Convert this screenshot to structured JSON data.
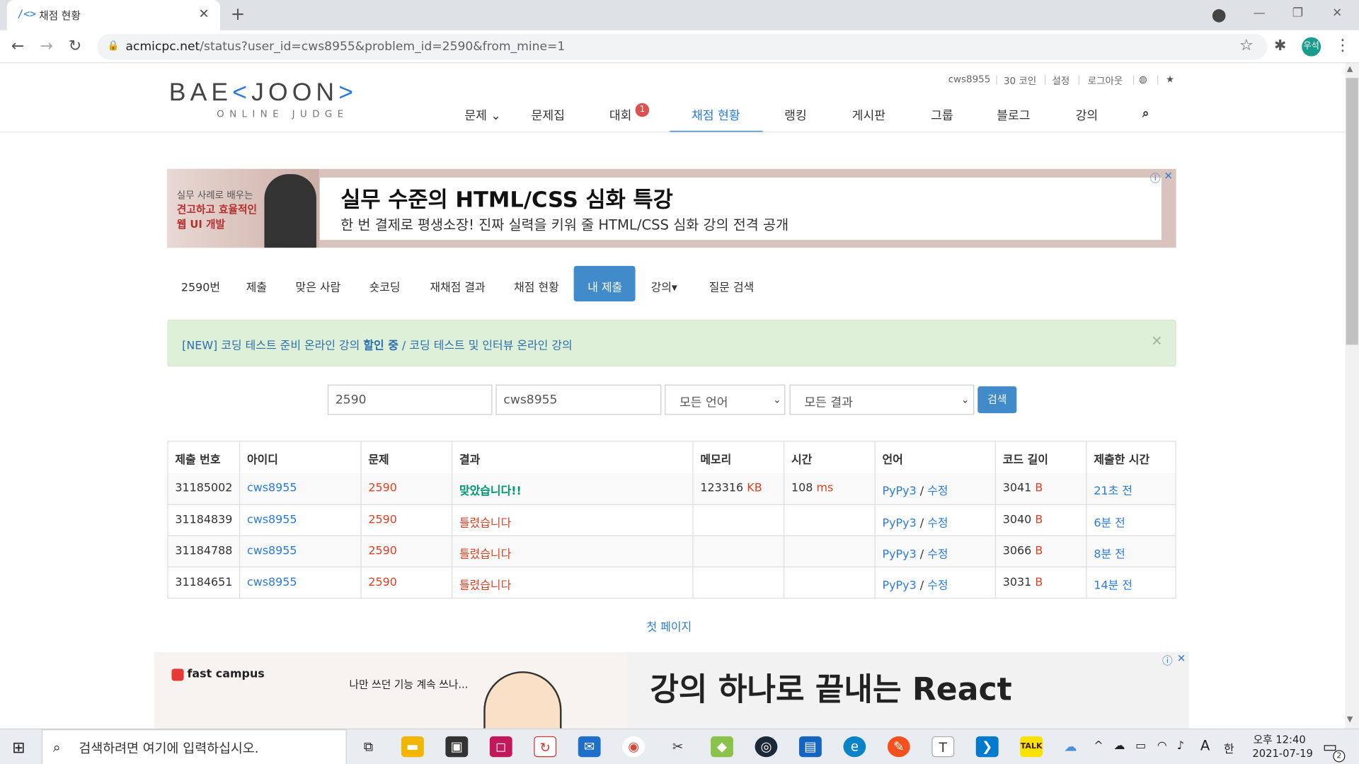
{
  "browser": {
    "tab_title": "채점 현황",
    "tab_favicon": "/<>",
    "url_host": "acmicpc.net",
    "url_path": "/status?user_id=cws8955&problem_id=2590&from_mine=1",
    "profile_label": "우석"
  },
  "header": {
    "logo_main": "BAE",
    "logo_bracket1": "<",
    "logo_mid": "JOON",
    "logo_bracket2": ">",
    "logo_sub": "ONLINE JUDGE",
    "top_links": [
      "cws8955",
      "30 코인",
      "설정",
      "로그아웃"
    ],
    "nav": [
      {
        "label": "문제 ⌄"
      },
      {
        "label": "문제집"
      },
      {
        "label": "대회"
      },
      {
        "label": "채점 현황"
      },
      {
        "label": "랭킹"
      },
      {
        "label": "게시판"
      },
      {
        "label": "그룹"
      },
      {
        "label": "블로그"
      },
      {
        "label": "강의"
      }
    ],
    "contest_badge": "1"
  },
  "ad_top": {
    "left_line1": "실무 사례로 배우는",
    "left_line2": "견고하고 효율적인",
    "left_line3": "웹 UI 개발",
    "title": "실무 수준의 HTML/CSS 심화 특강",
    "desc": "한 번 결제로 평생소장! 진짜 실력을 키워 줄 HTML/CSS 심화 강의 전격 공개"
  },
  "subnav": [
    "2590번",
    "제출",
    "맞은 사람",
    "숏코딩",
    "재채점 결과",
    "채점 현황",
    "내 제출",
    "강의▾",
    "질문 검색"
  ],
  "alert": {
    "prefix": "[NEW] 코딩 테스트 준비 온라인 강의 ",
    "bold": "할인 중",
    "suffix": " / 코딩 테스트 및 인터뷰 온라인 강의"
  },
  "filter": {
    "problem_id": "2590",
    "user_id": "cws8955",
    "language": "모든 언어",
    "result": "모든 결과",
    "search_label": "검색"
  },
  "table": {
    "headers": [
      "제출 번호",
      "아이디",
      "문제",
      "결과",
      "메모리",
      "시간",
      "언어",
      "코드 길이",
      "제출한 시간"
    ],
    "rows": [
      {
        "id": "31185002",
        "user": "cws8955",
        "problem": "2590",
        "result": "맞았습니다!!",
        "memory": "123316",
        "mem_unit": "KB",
        "time": "108",
        "time_unit": "ms",
        "lang": "PyPy3",
        "edit": "수정",
        "length": "3041",
        "len_unit": "B",
        "submitted": "21초 전",
        "ok": true
      },
      {
        "id": "31184839",
        "user": "cws8955",
        "problem": "2590",
        "result": "틀렸습니다",
        "memory": "",
        "mem_unit": "",
        "time": "",
        "time_unit": "",
        "lang": "PyPy3",
        "edit": "수정",
        "length": "3040",
        "len_unit": "B",
        "submitted": "6분 전",
        "ok": false
      },
      {
        "id": "31184788",
        "user": "cws8955",
        "problem": "2590",
        "result": "틀렸습니다",
        "memory": "",
        "mem_unit": "",
        "time": "",
        "time_unit": "",
        "lang": "PyPy3",
        "edit": "수정",
        "length": "3066",
        "len_unit": "B",
        "submitted": "8분 전",
        "ok": false
      },
      {
        "id": "31184651",
        "user": "cws8955",
        "problem": "2590",
        "result": "틀렸습니다",
        "memory": "",
        "mem_unit": "",
        "time": "",
        "time_unit": "",
        "lang": "PyPy3",
        "edit": "수정",
        "length": "3031",
        "len_unit": "B",
        "submitted": "14분 전",
        "ok": false
      }
    ]
  },
  "first_page": "첫 페이지",
  "ad_bottom": {
    "brand": "fast campus",
    "copy": "나만 쓰던 기능 계속 쓰나...",
    "title": "강의 하나로 끝내는 React"
  },
  "taskbar": {
    "search_placeholder": "검색하려면 여기에 입력하십시오.",
    "ime": "한",
    "ime_a": "A",
    "time": "오후 12:40",
    "date": "2021-07-19",
    "notif_count": "2"
  },
  "colors": {
    "accent": "#428bca",
    "link": "#2b7bd9",
    "error": "#dd4124",
    "success": "#009874"
  }
}
